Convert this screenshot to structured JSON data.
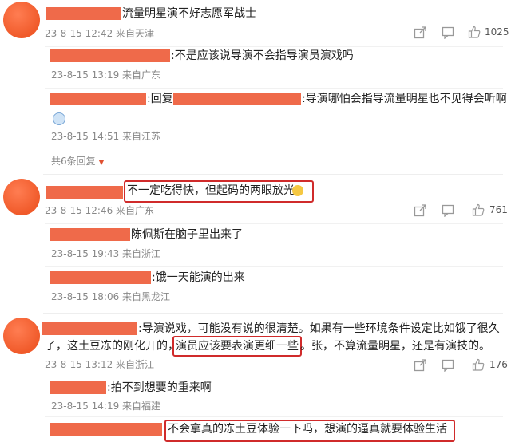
{
  "c1": {
    "text": "流量明星演不好志愿军战士",
    "meta": "23-8-15 12:42 来自天津",
    "likes": "1025",
    "replies": [
      {
        "text": ":不是应该说导演不会指导演员演戏吗",
        "meta": "23-8-15 13:19 来自广东"
      },
      {
        "prefix": ":回复",
        "text": ":导演哪怕会指导流量明星也不见得会听啊",
        "meta": "23-8-15 14:51 来自江苏"
      }
    ],
    "more": "共6条回复"
  },
  "c2": {
    "text": "不一定吃得快，但起码的两眼放光",
    "meta": "23-8-15 12:46 来自广东",
    "likes": "761",
    "replies": [
      {
        "text": "陈佩斯在脑子里出来了",
        "meta": "23-8-15 19:43 来自浙江"
      },
      {
        "text": ":饿一天能演的出来",
        "meta": "23-8-15 18:06 来自黑龙江"
      }
    ]
  },
  "c3": {
    "line1": ":导演说戏，可能没有说的很清楚。如果有一些环境条件设定比如饿了很久",
    "line2a": "了，这土豆冻的刚化开的，",
    "line2b": "演员应该要表演更细一些",
    "line2c": "。张，不算流量明星，还是有演技的。",
    "meta": "23-8-15 13:12 来自浙江",
    "likes": "176",
    "replies": [
      {
        "text": ":拍不到想要的重来啊",
        "meta": "23-8-15 14:19 来自福建"
      },
      {
        "text": "不会拿真的冻土豆体验一下吗，想演的逼真就要体验生活"
      }
    ]
  },
  "colors": {
    "accent": "#d02b2b",
    "redact": "#ef6a4a"
  }
}
